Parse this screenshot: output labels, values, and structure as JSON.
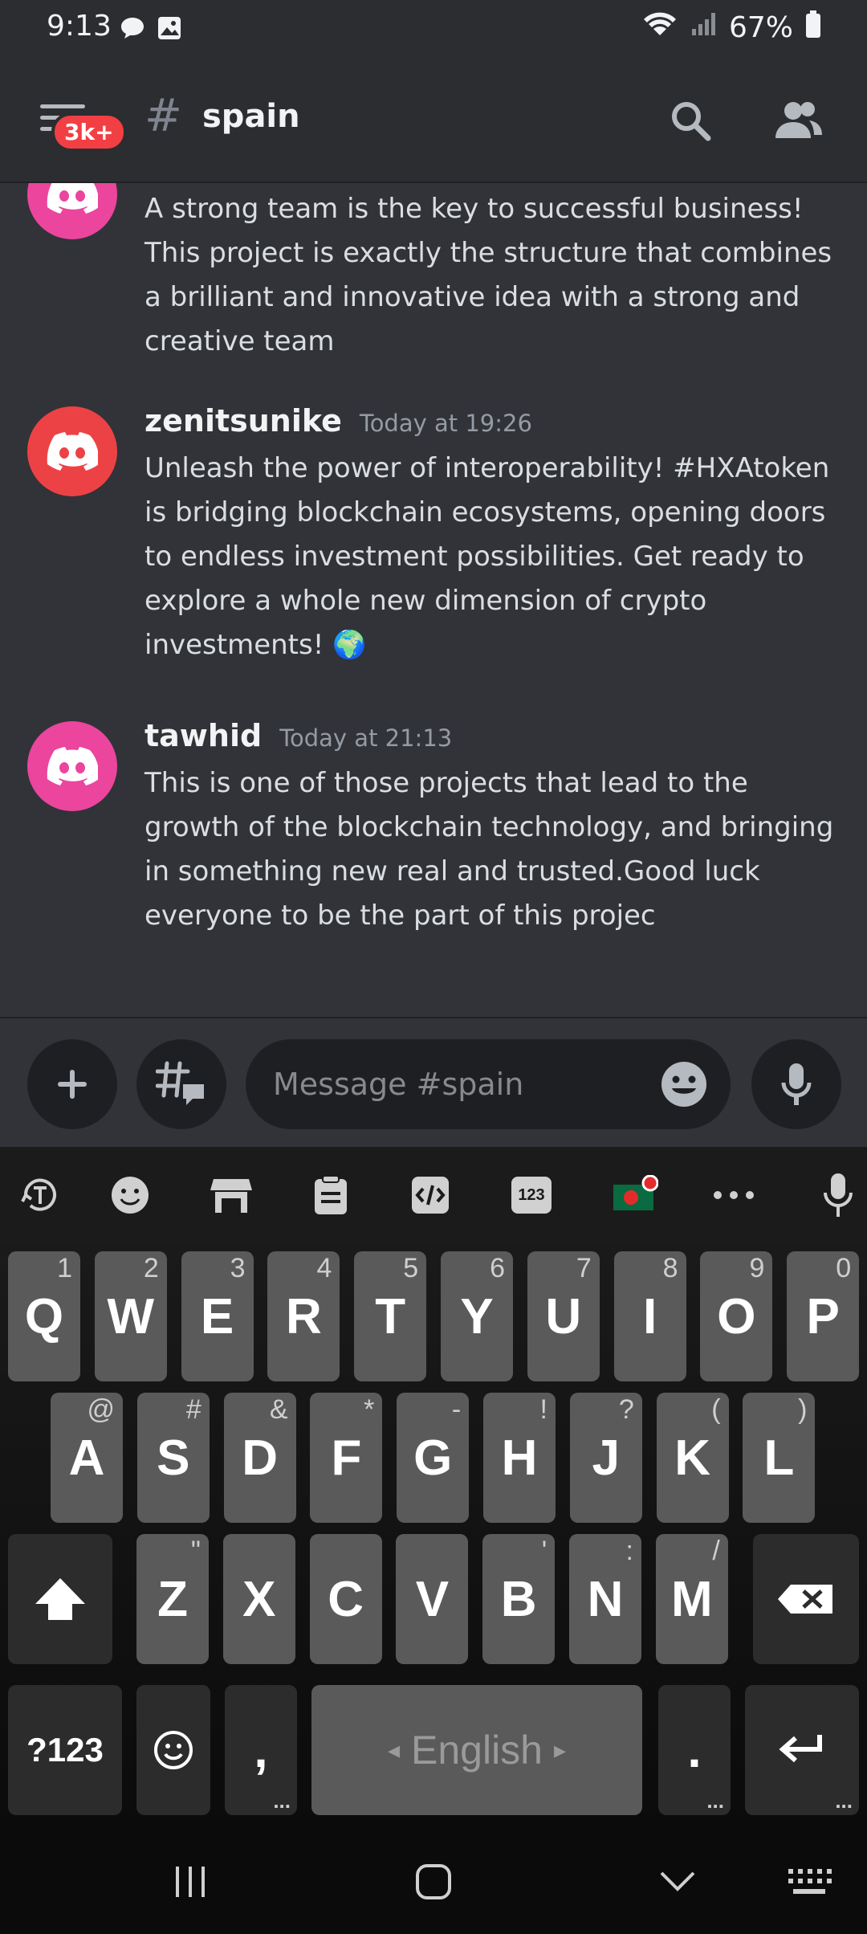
{
  "status_bar": {
    "time": "9:13",
    "battery": "67%"
  },
  "header": {
    "badge": "3k+",
    "hash": "#",
    "channel": "spain"
  },
  "messages": [
    {
      "author": "",
      "timestamp": "",
      "avatar_color": "#eb459e",
      "text": "A strong team is the key to successful business! This project is exactly the structure that combines a brilliant and innovative idea with a strong and creative team"
    },
    {
      "author": "zenitsunike",
      "timestamp": "Today at 19:26",
      "avatar_color": "#ed4245",
      "text": "Unleash the power of interoperability! #HXAtoken is bridging blockchain ecosystems, opening doors to endless investment possibilities. Get ready to explore a whole new dimension of crypto investments!",
      "emoji": "🌍"
    },
    {
      "author": "tawhid",
      "timestamp": "Today at 21:13",
      "avatar_color": "#eb459e",
      "text": "This is one of those projects that lead to the growth of the blockchain technology, and bringing in something new real and trusted.Good luck everyone to be the part of this projec"
    }
  ],
  "composer": {
    "placeholder": "Message #spain"
  },
  "keyboard": {
    "toolbar": {
      "numbers_label": "123"
    },
    "row1": [
      {
        "k": "Q",
        "h": "1"
      },
      {
        "k": "W",
        "h": "2"
      },
      {
        "k": "E",
        "h": "3"
      },
      {
        "k": "R",
        "h": "4"
      },
      {
        "k": "T",
        "h": "5"
      },
      {
        "k": "Y",
        "h": "6"
      },
      {
        "k": "U",
        "h": "7"
      },
      {
        "k": "I",
        "h": "8"
      },
      {
        "k": "O",
        "h": "9"
      },
      {
        "k": "P",
        "h": "0"
      }
    ],
    "row2": [
      {
        "k": "A",
        "h": "@"
      },
      {
        "k": "S",
        "h": "#"
      },
      {
        "k": "D",
        "h": "&"
      },
      {
        "k": "F",
        "h": "*"
      },
      {
        "k": "G",
        "h": "-"
      },
      {
        "k": "H",
        "h": "!"
      },
      {
        "k": "J",
        "h": "?"
      },
      {
        "k": "K",
        "h": "("
      },
      {
        "k": "L",
        "h": ")"
      }
    ],
    "row3": [
      {
        "k": "Z",
        "h": "\""
      },
      {
        "k": "X",
        "h": ""
      },
      {
        "k": "C",
        "h": ""
      },
      {
        "k": "V",
        "h": ""
      },
      {
        "k": "B",
        "h": "'"
      },
      {
        "k": "N",
        "h": ":"
      },
      {
        "k": "M",
        "h": "/"
      }
    ],
    "symbols_label": "?123",
    "comma": ",",
    "period": ".",
    "space_label": "English"
  },
  "colors": {
    "background": "#313338",
    "header": "#2b2d31",
    "key": "#5a5a5a",
    "badge": "#f23f43"
  }
}
